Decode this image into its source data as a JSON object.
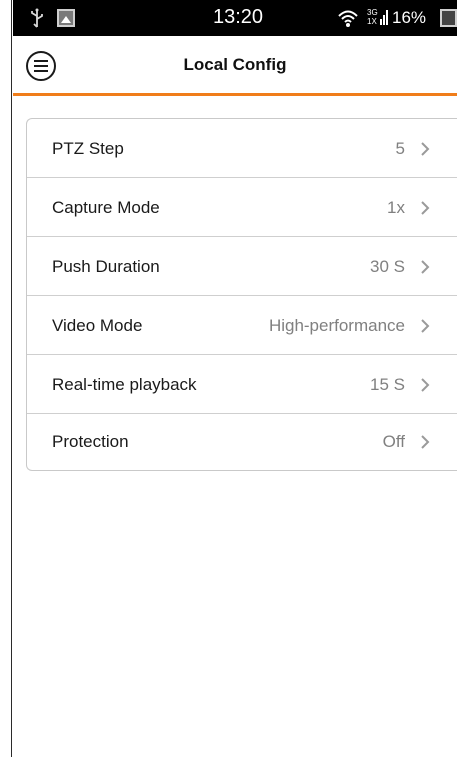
{
  "status_bar": {
    "time": "13:20",
    "network": "3G 1X",
    "battery": "16%",
    "icons": [
      "usb-icon",
      "image-notification-icon",
      "wifi-icon",
      "signal-icon",
      "battery-icon"
    ]
  },
  "header": {
    "title": "Local Config",
    "menu_icon": "menu-icon",
    "accent_color": "#f07d1a"
  },
  "settings": [
    {
      "label": "PTZ Step",
      "value": "5"
    },
    {
      "label": "Capture Mode",
      "value": "1x"
    },
    {
      "label": "Push Duration",
      "value": "30 S"
    },
    {
      "label": "Video Mode",
      "value": "High-performance"
    },
    {
      "label": "Real-time playback",
      "value": "15 S"
    },
    {
      "label": "Protection",
      "value": "Off"
    }
  ]
}
